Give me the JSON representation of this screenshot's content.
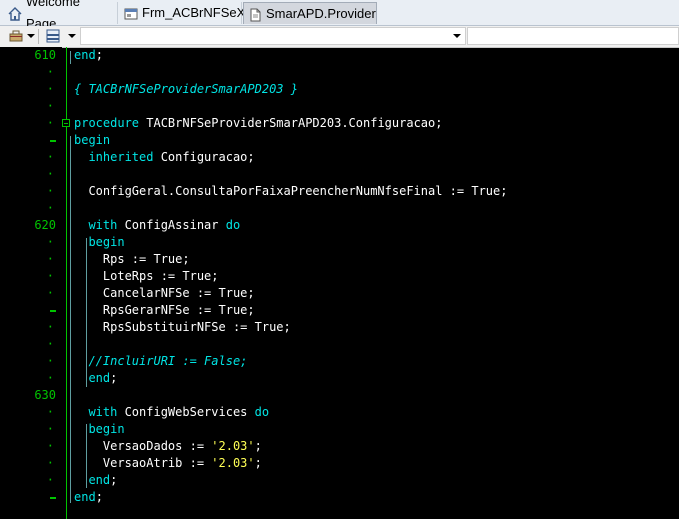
{
  "tabs": [
    {
      "label": "Welcome Page",
      "icon": "home-icon",
      "active": false
    },
    {
      "label": "Frm_ACBrNFSeX",
      "icon": "form-icon",
      "active": false
    },
    {
      "label": "SmarAPD.Provider",
      "icon": "unit-file-icon",
      "active": true
    }
  ],
  "toolbar": {
    "combo_left_value": "",
    "combo_right_value": ""
  },
  "gutter": {
    "numbers": [
      "610",
      "630",
      "620"
    ],
    "dot": "·"
  },
  "code": [
    "end;",
    "",
    "{ TACBrNFSeProviderSmarAPD203 }",
    "",
    "procedure TACBrNFSeProviderSmarAPD203.Configuracao;",
    "begin",
    "  inherited Configuracao;",
    "",
    "  ConfigGeral.ConsultaPorFaixaPreencherNumNfseFinal := True;",
    "",
    "  with ConfigAssinar do",
    "  begin",
    "    Rps := True;",
    "    LoteRps := True;",
    "    CancelarNFSe := True;",
    "    RpsGerarNFSe := True;",
    "    RpsSubstituirNFSe := True;",
    "",
    "  //IncluirURI := False;",
    "  end;",
    "",
    "  with ConfigWebServices do",
    "  begin",
    "    VersaoDados := '2.03';",
    "    VersaoAtrib := '2.03';",
    "  end;",
    "end;"
  ],
  "tokens": {
    "end": "end",
    "begin": "begin",
    "procedure": "procedure",
    "inherited": "inherited",
    "with": "with",
    "do": "do",
    "true": "True",
    "false": "False",
    "v203": "'2.03'"
  }
}
